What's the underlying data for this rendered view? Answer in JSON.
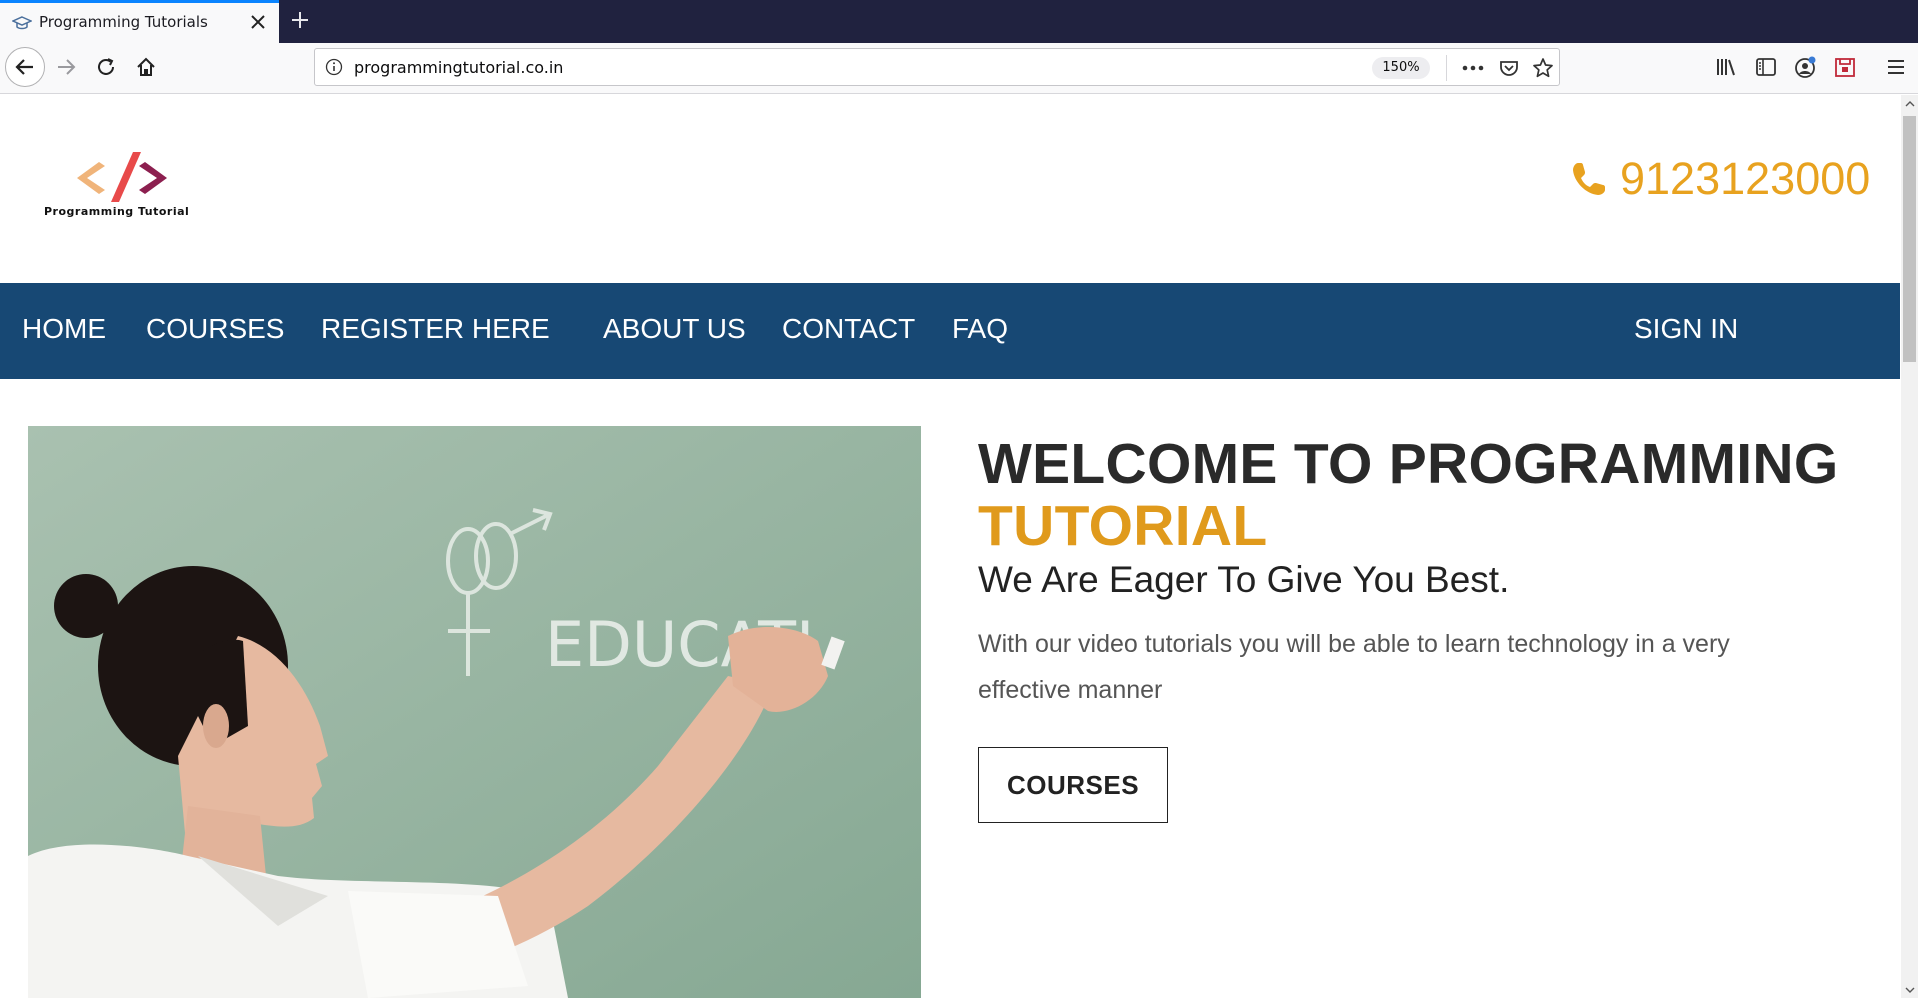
{
  "browser": {
    "tab_title": "Programming Tutorials",
    "url": "programmingtutorial.co.in",
    "zoom": "150%"
  },
  "site": {
    "logo_text": "Programming Tutorial",
    "phone": "9123123000",
    "menu": {
      "home": "HOME",
      "courses": "COURSES",
      "register": "REGISTER HERE",
      "about": "ABOUT US",
      "contact": "CONTACT",
      "faq": "FAQ",
      "signin": "SIGN IN"
    },
    "hero": {
      "title_line1": "WELCOME TO PROGRAMMING",
      "title_line2": "TUTORIAL",
      "tagline": "We Are Eager To Give You Best.",
      "description": "With our video tutorials you will be able to learn technology in a very effective manner",
      "button": "COURSES",
      "image_chalk_text": "EDUCATI"
    }
  },
  "colors": {
    "menu_bg": "#174874",
    "accent": "#e09a1c",
    "tab_accent": "#0a84ff"
  }
}
